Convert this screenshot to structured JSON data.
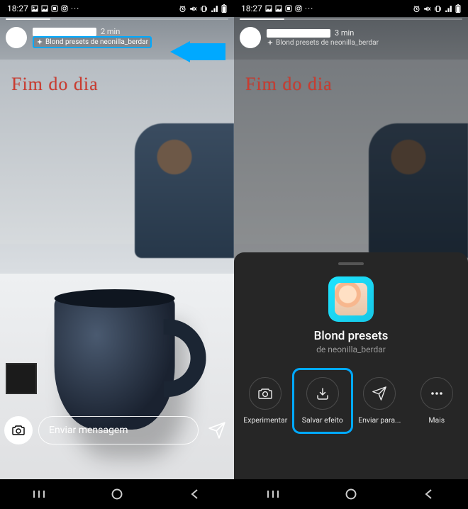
{
  "status": {
    "time": "18:27",
    "left_icons": [
      "image-icon",
      "image-icon",
      "screenshot-icon",
      "instagram-icon"
    ],
    "left_dots": "···",
    "right_icons": [
      "alarm-icon",
      "mute-icon",
      "vibrate-icon",
      "wifi-icon",
      "signal-icon",
      "battery-icon"
    ]
  },
  "left": {
    "story": {
      "username_redacted": true,
      "time": "2 min",
      "effect_label": "Blond presets de neonilla_berdar",
      "caption": "Fim do dia"
    },
    "reply": {
      "placeholder": "Enviar mensagem"
    }
  },
  "right": {
    "story": {
      "username_redacted": true,
      "time": "3 min",
      "effect_label": "Blond presets de neonilla_berdar",
      "caption": "Fim do dia"
    },
    "sheet": {
      "title": "Blond presets",
      "author_prefix": "de ",
      "author": "neonilla_berdar",
      "actions": {
        "try": "Experimentar",
        "save": "Salvar efeito",
        "send": "Enviar para...",
        "more": "Mais"
      }
    }
  },
  "nav": {
    "recent": "|||",
    "home": "○",
    "back": "<"
  },
  "colors": {
    "highlight": "#00a9ff",
    "caption": "#cc3b2f",
    "sheet": "#262626"
  }
}
